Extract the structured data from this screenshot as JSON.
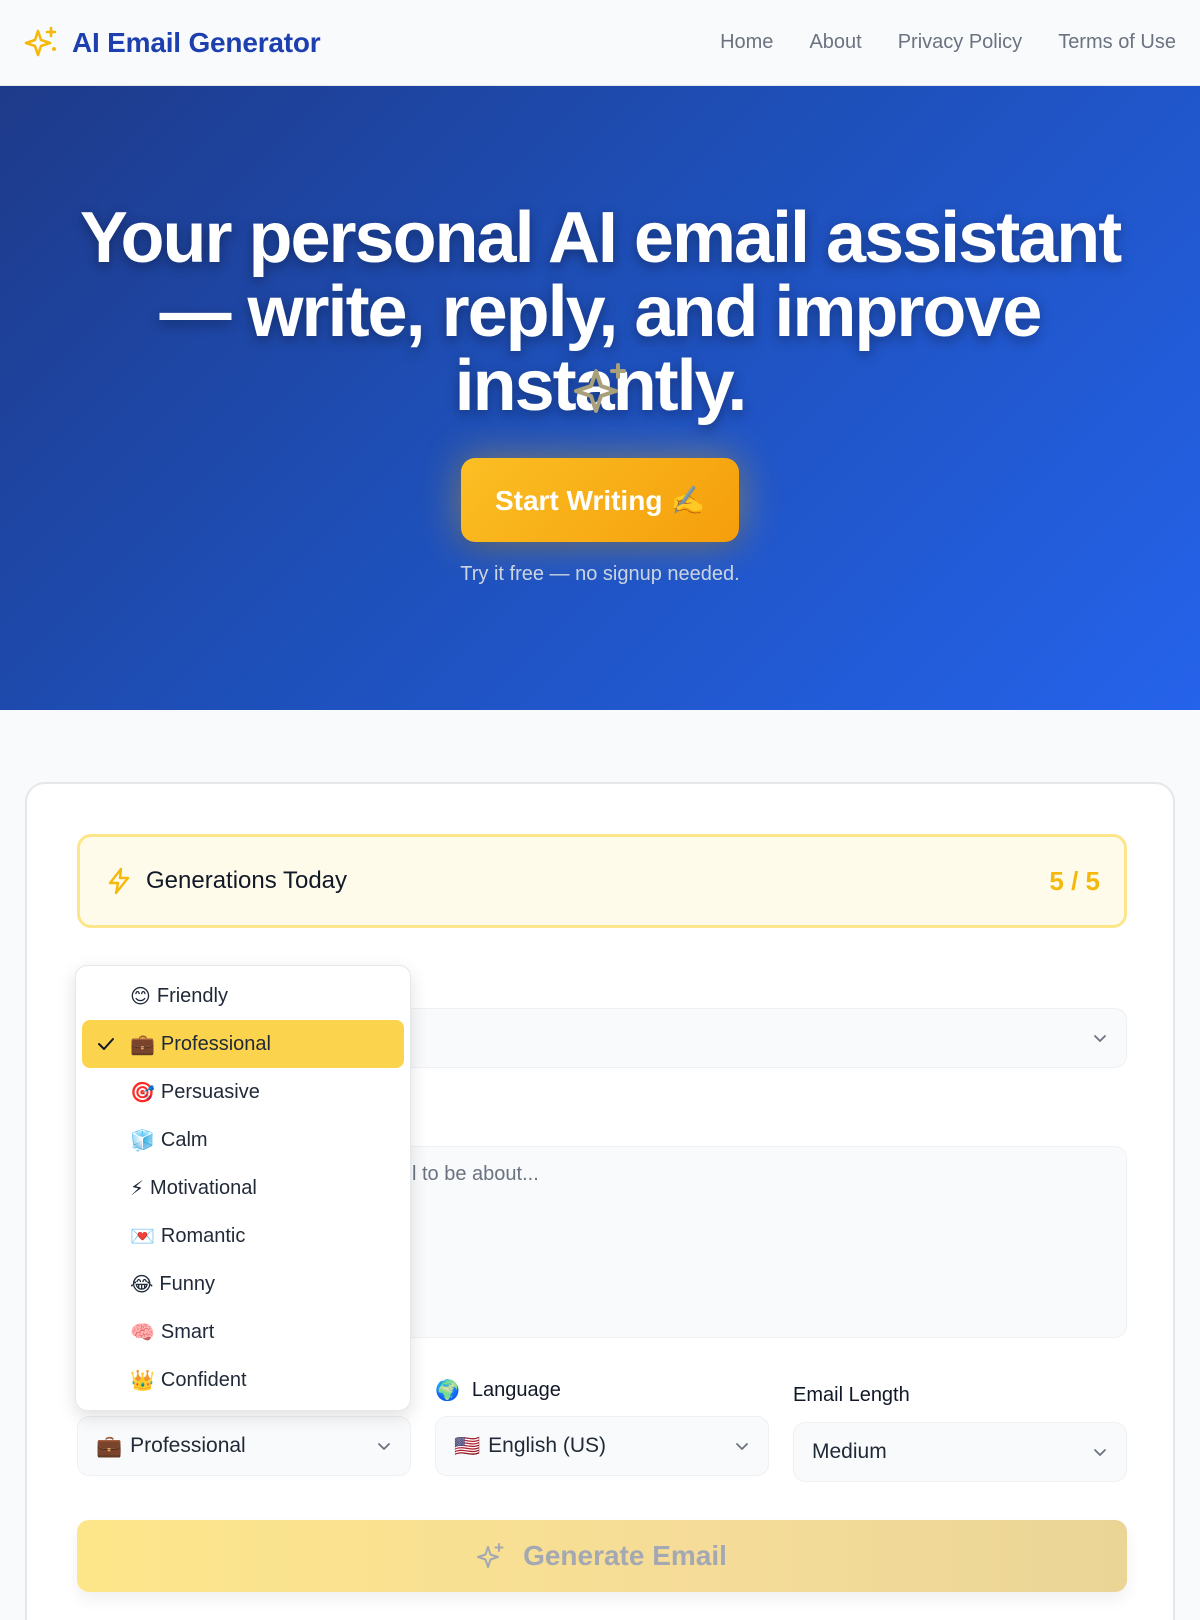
{
  "header": {
    "title": "AI Email Generator",
    "nav": [
      "Home",
      "About",
      "Privacy Policy",
      "Terms of Use"
    ]
  },
  "hero": {
    "title": "Your personal AI email assistant — write, reply, and improve instantly.",
    "cta_label": "Start Writing ✍️",
    "subtitle": "Try it free — no signup needed."
  },
  "generations": {
    "label": "Generations Today",
    "count": "5 / 5"
  },
  "prompt": {
    "placeholder_visible": "l to be about..."
  },
  "tone": {
    "selected_emoji": "💼",
    "selected_label": "Professional",
    "options": [
      {
        "emoji": "😊",
        "label": "Friendly"
      },
      {
        "emoji": "💼",
        "label": "Professional"
      },
      {
        "emoji": "🎯",
        "label": "Persuasive"
      },
      {
        "emoji": "🧊",
        "label": "Calm"
      },
      {
        "emoji": "⚡",
        "label": "Motivational"
      },
      {
        "emoji": "💌",
        "label": "Romantic"
      },
      {
        "emoji": "😂",
        "label": "Funny"
      },
      {
        "emoji": "🧠",
        "label": "Smart"
      },
      {
        "emoji": "👑",
        "label": "Confident"
      }
    ]
  },
  "language": {
    "label": "Language",
    "label_emoji": "🌍",
    "selected_flag": "🇺🇸",
    "selected": "English (US)"
  },
  "length": {
    "label": "Email Length",
    "selected": "Medium"
  },
  "generate": {
    "label": "Generate Email"
  },
  "colors": {
    "brand": "#1e40af",
    "accent": "#fbbf24",
    "hero_start": "#1e3a8a",
    "hero_end": "#2563eb",
    "selected_option": "#fcd34d"
  }
}
